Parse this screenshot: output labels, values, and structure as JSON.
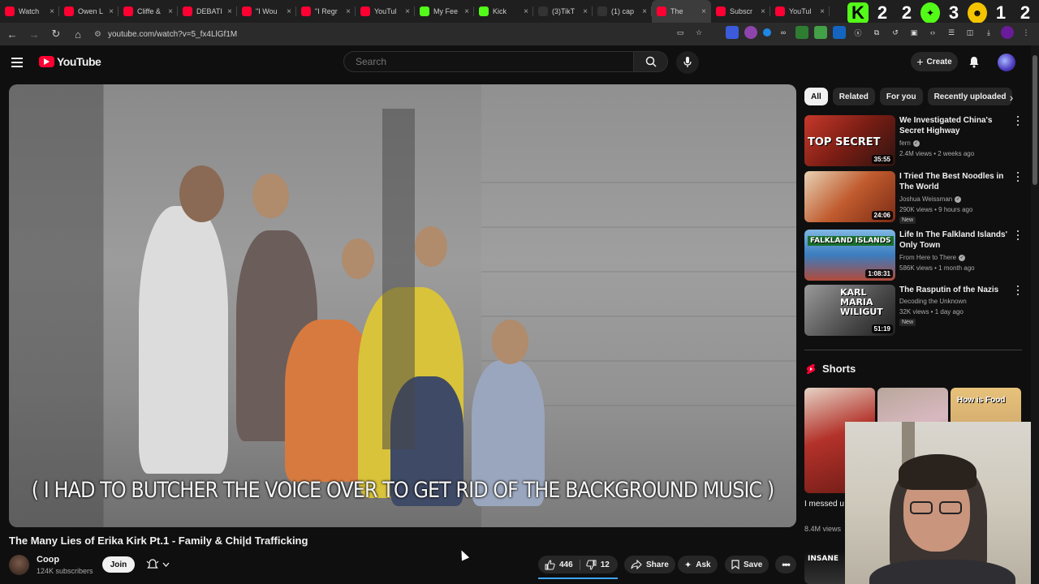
{
  "browser": {
    "tabs": [
      {
        "title": "Watch",
        "color": "#ff0033"
      },
      {
        "title": "Owen L",
        "color": "#ff0033"
      },
      {
        "title": "Cliffe &",
        "color": "#ff0033"
      },
      {
        "title": "DEBATI",
        "color": "#ff0033"
      },
      {
        "title": "\"I Wou",
        "color": "#ff0033"
      },
      {
        "title": "\"I Regr",
        "color": "#ff0033"
      },
      {
        "title": "YouTul",
        "color": "#ff0033"
      },
      {
        "title": "My Fee",
        "color": "#53fc18"
      },
      {
        "title": "Kick",
        "color": "#53fc18"
      },
      {
        "title": "(3)TikT",
        "color": "#333333"
      },
      {
        "title": "(1) cap",
        "color": "#333333"
      },
      {
        "title": "The",
        "color": "#ff0033"
      },
      {
        "title": "Subscr",
        "color": "#ff0033"
      },
      {
        "title": "YouTul",
        "color": "#ff0033"
      }
    ],
    "active_tab_index": 11,
    "url": "youtube.com/watch?v=5_fx4LlGf1M",
    "overlay_numbers": [
      "2",
      "2",
      "3",
      "1",
      "2"
    ]
  },
  "header": {
    "logo_text": "YouTube",
    "search_placeholder": "Search",
    "create_label": "Create"
  },
  "video": {
    "subtitle": "( I HAD TO BUTCHER THE VOICE OVER TO GET RID OF THE BACKGROUND MUSIC )",
    "title": "The Many Lies of Erika Kirk Pt.1 - Family & Chi|d Trafficking",
    "channel": "Coop",
    "subscribers": "124K subscribers",
    "join_label": "Join",
    "likes": "446",
    "dislikes": "12",
    "share_label": "Share",
    "ask_label": "Ask",
    "save_label": "Save"
  },
  "sidebar": {
    "chips": [
      "All",
      "Related",
      "For you",
      "Recently uploaded"
    ],
    "recommendations": [
      {
        "title": "We Investigated China's Secret Highway",
        "channel": "fern",
        "verified": true,
        "meta": "2.4M views • 2 weeks ago",
        "duration": "35:55",
        "thumb_text": "TOP SECRET",
        "badge": ""
      },
      {
        "title": "I Tried The Best Noodles in The World",
        "channel": "Joshua Weissman",
        "verified": true,
        "meta": "290K views • 9 hours ago",
        "duration": "24:06",
        "thumb_text": "",
        "badge": "New"
      },
      {
        "title": "Life In The Falkland Islands' Only Town",
        "channel": "From Here to There",
        "verified": true,
        "meta": "586K views • 1 month ago",
        "duration": "1:08:31",
        "thumb_text": "FALKLAND ISLANDS",
        "badge": ""
      },
      {
        "title": "The Rasputin of the Nazis",
        "channel": "Decoding the Unknown",
        "verified": false,
        "meta": "32K views • 1 day ago",
        "duration": "51:19",
        "thumb_text": "KARL MARIA WILIGUT",
        "badge": "New"
      }
    ],
    "shorts_label": "Shorts",
    "short1_title": "I messed u",
    "short1_views": "8.4M views",
    "short3_text": "How is Food"
  }
}
